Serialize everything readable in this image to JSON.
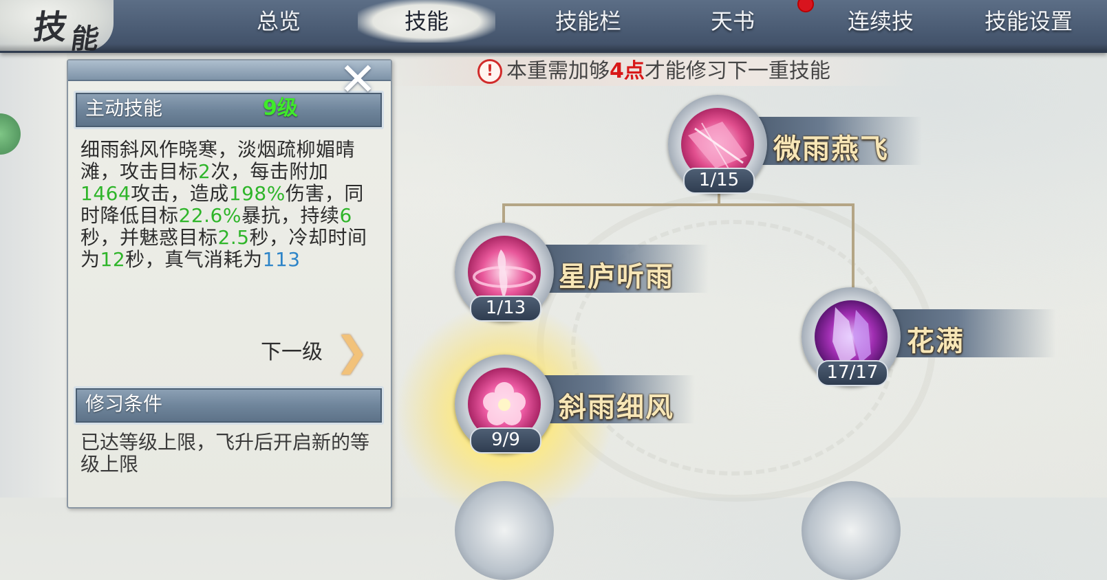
{
  "header": {
    "logo_char_1": "技",
    "logo_char_2": "能",
    "tabs": [
      {
        "label": "总览",
        "active": false
      },
      {
        "label": "技能",
        "active": true
      },
      {
        "label": "技能栏",
        "active": false
      },
      {
        "label": "天书",
        "active": false,
        "notification": true
      },
      {
        "label": "连续技",
        "active": false
      },
      {
        "label": "技能设置",
        "active": false
      }
    ]
  },
  "detail_panel": {
    "active_skill_header": "主动技能",
    "active_skill_level": "9级",
    "description_parts": {
      "p1": "细雨斜风作晓寒，淡烟疏柳媚晴滩，攻击目标",
      "hits": "2",
      "p2": "次，每击附加",
      "bonus_attack": "1464",
      "p3": "攻击，造成",
      "damage_pct": "198%",
      "p4": "伤害，同时降低目标",
      "crit_res_pct": "22.6%",
      "p5": "暴抗，持续",
      "duration": "6",
      "p6": "秒，并魅惑目标",
      "charm": "2.5",
      "p7": "秒，冷却时间为",
      "cooldown": "12",
      "p8": "秒，真气消耗为",
      "cost": "113"
    },
    "next_level_label": "下一级",
    "requirements_header": "修习条件",
    "requirements_text": "已达等级上限，飞升后开启新的等级上限"
  },
  "tip": {
    "icon": "exclamation-icon",
    "text_before": "本重需加够",
    "highlight": "4点",
    "text_after": "才能修习下一重技能"
  },
  "skill_tree": [
    {
      "name": "微雨燕飞",
      "progress": "1/15",
      "icon": "umbrella-skill-icon"
    },
    {
      "name": "星庐听雨",
      "progress": "1/13",
      "icon": "dancer-skill-icon"
    },
    {
      "name": "花满",
      "progress": "17/17",
      "icon": "crystal-skill-icon"
    },
    {
      "name": "斜雨细风",
      "progress": "9/9",
      "icon": "flower-skill-icon",
      "selected": true
    }
  ],
  "colors": {
    "green_value": "#2fb52a",
    "blue_value": "#2d84c8",
    "level_green": "#3fea2a",
    "tip_red": "#d81818",
    "name_gold": "#f7e6b6"
  }
}
